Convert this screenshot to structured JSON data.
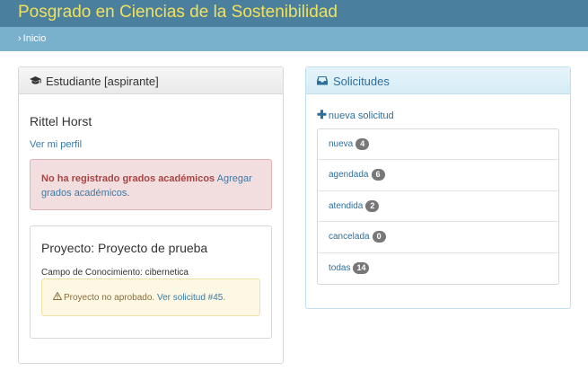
{
  "header": {
    "title": "Posgrado en Ciencias de la Sostenibilidad"
  },
  "breadcrumb": {
    "separator": "›",
    "home": "Inicio"
  },
  "student_panel": {
    "icon": "graduation-cap-icon",
    "title": "Estudiante [aspirante]",
    "name": "Rittel Horst",
    "profile_link": "Ver mi perfil",
    "alert": {
      "bold": "No ha registrado grados académicos",
      "link": "Agregar grados académicos",
      "end": "."
    },
    "project": {
      "title": "Proyecto: Proyecto de prueba",
      "field": "Campo de Conocimiento: cibernetica",
      "warning_icon": "warning-icon",
      "warning_text": "Proyecto no aprobado. ",
      "warning_link": "Ver solicitud #45",
      "warning_end": "."
    }
  },
  "requests_panel": {
    "icon": "inbox-icon",
    "title": "Solicitudes",
    "new_request": "nueva solicitud",
    "items": [
      {
        "label": "nueva",
        "count": "4"
      },
      {
        "label": "agendada",
        "count": "6"
      },
      {
        "label": "atendida",
        "count": "2"
      },
      {
        "label": "cancelada",
        "count": "0"
      },
      {
        "label": "todas",
        "count": "14"
      }
    ]
  },
  "colors": {
    "topbar": "#4a7f9e",
    "brand_text": "#f2e15a",
    "crumbbar": "#79b0cb",
    "link": "#3a79a8",
    "danger_bg": "#f2dede",
    "warning_bg": "#fcf8e3",
    "badge": "#777777"
  }
}
